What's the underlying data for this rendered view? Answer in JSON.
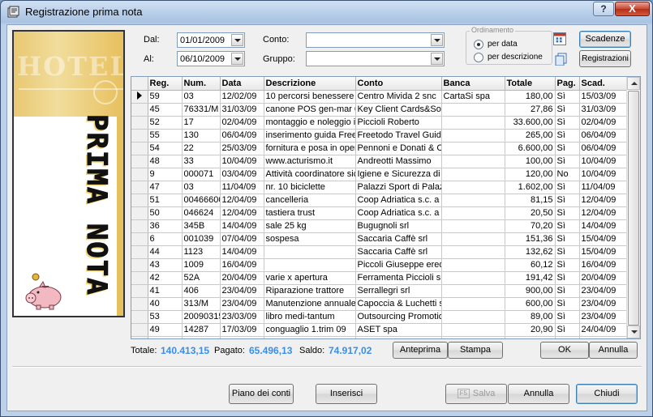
{
  "window": {
    "title": "Registrazione prima nota",
    "help_label": "?",
    "close_label": "X"
  },
  "banner": {
    "ghost_text": "HOTEL",
    "text": "PRIMA NOTA"
  },
  "filters": {
    "dal_label": "Dal:",
    "dal_value": "01/01/2009",
    "al_label": "Al:",
    "al_value": "06/10/2009",
    "conto_label": "Conto:",
    "conto_value": "",
    "gruppo_label": "Gruppo:",
    "gruppo_value": ""
  },
  "ordinamento": {
    "title": "Ordinamento",
    "options": [
      "per data",
      "per descrizione"
    ],
    "selected": "per data"
  },
  "side_buttons": {
    "scadenze": "Scadenze",
    "registrazioni": "Registrazioni"
  },
  "table": {
    "columns": [
      "Reg.",
      "Num.",
      "Data",
      "Descrizione",
      "Conto",
      "Banca",
      "Totale",
      "Pag.",
      "Scad."
    ],
    "rows": [
      [
        "59",
        "03",
        "12/02/09",
        "10 percorsi benessere",
        "Centro Mivida 2 snc",
        "CartaSi spa",
        "180,00",
        "Sì",
        "15/03/09"
      ],
      [
        "45",
        "76331/M",
        "31/03/09",
        "canone POS gen-mar 09",
        "Key Client Cards&Solutions",
        "",
        "27,86",
        "Sì",
        "31/03/09"
      ],
      [
        "52",
        "17",
        "02/04/09",
        "montaggio e noleggio impianto",
        "Piccioli Roberto",
        "",
        "33.600,00",
        "Sì",
        "02/04/09"
      ],
      [
        "55",
        "130",
        "06/04/09",
        "inserimento guida Freetodo",
        "Freetodo Travel Guide",
        "",
        "265,00",
        "Sì",
        "06/04/09"
      ],
      [
        "54",
        "22",
        "25/03/09",
        "fornitura e posa in opera",
        "Pennoni e Donati & C",
        "",
        "6.600,00",
        "Sì",
        "06/04/09"
      ],
      [
        "48",
        "33",
        "10/04/09",
        "www.acturismo.it",
        "Andreotti Massimo",
        "",
        "100,00",
        "Sì",
        "10/04/09"
      ],
      [
        "9",
        "000071",
        "03/04/09",
        "Attività coordinatore sicurezza",
        "Igiene e Sicurezza di C",
        "",
        "120,00",
        "No",
        "10/04/09"
      ],
      [
        "47",
        "03",
        "11/04/09",
        "nr. 10 biciclette",
        "Palazzi Sport di Palazzi",
        "",
        "1.602,00",
        "Sì",
        "11/04/09"
      ],
      [
        "51",
        "00466600",
        "12/04/09",
        "cancelleria",
        "Coop Adriatica s.c. a r.l.",
        "",
        "81,15",
        "Sì",
        "12/04/09"
      ],
      [
        "50",
        "046624",
        "12/04/09",
        "tastiera trust",
        "Coop Adriatica s.c. a r.l.",
        "",
        "20,50",
        "Sì",
        "12/04/09"
      ],
      [
        "36",
        "345B",
        "14/04/09",
        "sale 25 kg",
        "Bugugnoli srl",
        "",
        "70,20",
        "Sì",
        "14/04/09"
      ],
      [
        "6",
        "001039",
        "07/04/09",
        "sospesa",
        "Saccaria Caffè srl",
        "",
        "151,36",
        "Sì",
        "15/04/09"
      ],
      [
        "44",
        "1123",
        "14/04/09",
        "",
        "Saccaria Caffè srl",
        "",
        "132,62",
        "Sì",
        "15/04/09"
      ],
      [
        "43",
        "1009",
        "16/04/09",
        "",
        "Piccoli Giuseppe eredi",
        "",
        "60,12",
        "Sì",
        "16/04/09"
      ],
      [
        "42",
        "52A",
        "20/04/09",
        "varie x apertura",
        "Ferramenta Piccioli snc",
        "",
        "191,42",
        "Sì",
        "20/04/09"
      ],
      [
        "41",
        "406",
        "23/04/09",
        "Riparazione trattore",
        "Serrallegri srl",
        "",
        "900,00",
        "Sì",
        "23/04/09"
      ],
      [
        "40",
        "313/M",
        "23/04/09",
        "Manutenzione annuale",
        "Capoccia & Luchetti snc",
        "",
        "600,00",
        "Sì",
        "23/04/09"
      ],
      [
        "53",
        "20090315",
        "23/03/09",
        "libro medi-tantum",
        "Outsourcing Promotion",
        "",
        "89,00",
        "Sì",
        "23/04/09"
      ],
      [
        "49",
        "14287",
        "17/03/09",
        "conguaglio 1.trim 09",
        "ASET spa",
        "",
        "20,90",
        "Sì",
        "24/04/09"
      ]
    ],
    "partial_row": [
      "139",
      "76/09",
      "29/04/09",
      "",
      "PRI Calibrazioni Dual",
      "",
      "220,34",
      "Sì",
      "29/04/09"
    ]
  },
  "totals": {
    "totale_label": "Totale:",
    "totale_value": "140.413,15",
    "pagato_label": "Pagato:",
    "pagato_value": "65.496,13",
    "saldo_label": "Saldo:",
    "saldo_value": "74.917,02"
  },
  "mid_buttons": {
    "anteprima": "Anteprima",
    "stampa": "Stampa",
    "ok": "OK",
    "annulla": "Annulla"
  },
  "bottom_buttons": {
    "piano": "Piano dei conti",
    "inserisci": "Inserisci",
    "salva_key": "F5",
    "salva": "Salva",
    "annulla": "Annulla",
    "chiudi": "Chiudi"
  },
  "colors": {
    "accent": "#3a8ee6",
    "window_frame": "#3b5273"
  }
}
